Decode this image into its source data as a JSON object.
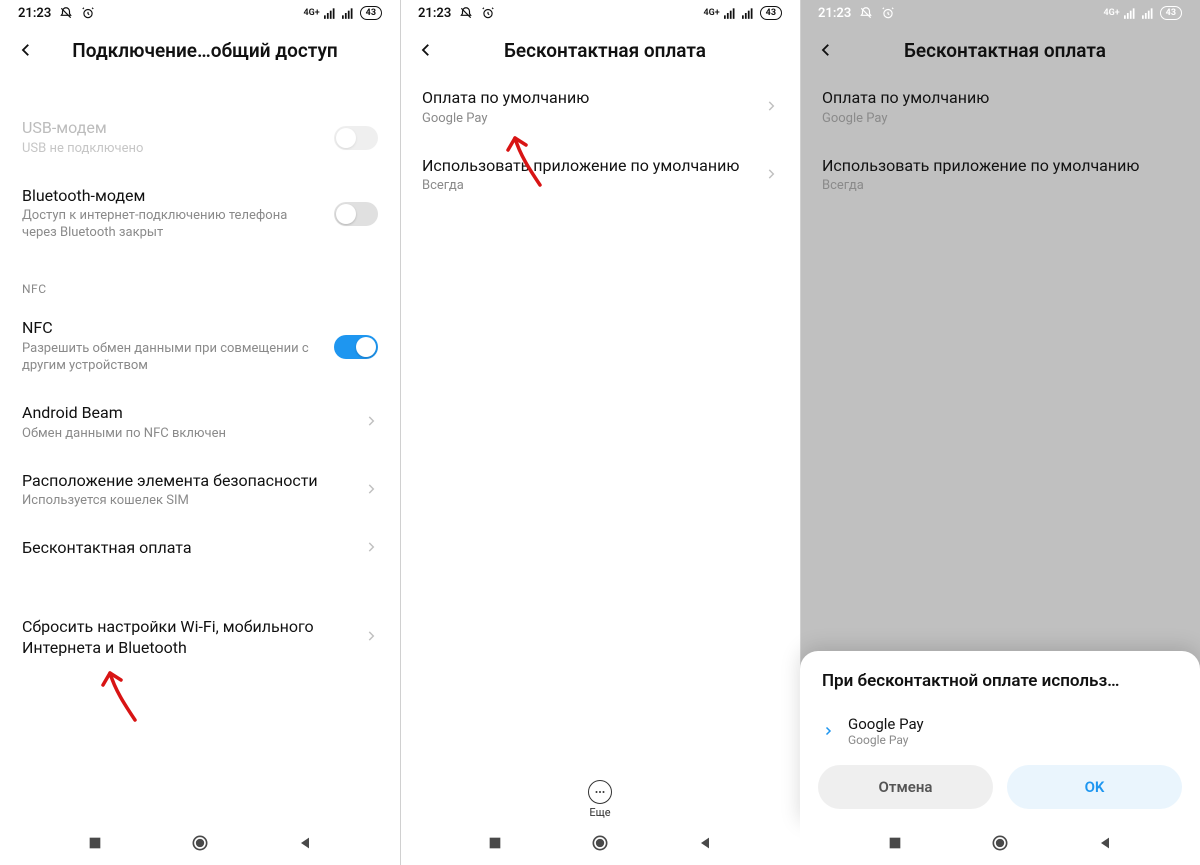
{
  "status": {
    "time": "21:23",
    "network": "4G+",
    "battery": "43"
  },
  "screen1": {
    "title": "Подключение…общий доступ",
    "usb": {
      "title": "USB-модем",
      "sub": "USB не подключено"
    },
    "bt": {
      "title": "Bluetooth-модем",
      "sub": "Доступ к интернет-подключению телефона через Bluetooth закрыт"
    },
    "section": "NFC",
    "nfc": {
      "title": "NFC",
      "sub": "Разрешить обмен данными при совмещении с другим устройством"
    },
    "beam": {
      "title": "Android Beam",
      "sub": "Обмен данными по NFC включен"
    },
    "sec": {
      "title": "Расположение элемента безопасности",
      "sub": "Используется кошелек SIM"
    },
    "pay": {
      "title": "Бесконтактная оплата"
    },
    "reset": {
      "title": "Сбросить настройки Wi-Fi, мобильного Интернета и Bluetooth"
    }
  },
  "screen2": {
    "title": "Бесконтактная оплата",
    "def": {
      "title": "Оплата по умолчанию",
      "sub": "Google Pay"
    },
    "use": {
      "title": "Использовать приложение по умолчанию",
      "sub": "Всегда"
    },
    "more": "Еще"
  },
  "screen3": {
    "title": "Бесконтактная оплата",
    "def": {
      "title": "Оплата по умолчанию",
      "sub": "Google Pay"
    },
    "use": {
      "title": "Использовать приложение по умолчанию",
      "sub": "Всегда"
    },
    "sheet": {
      "title": "При бесконтактной оплате использ…",
      "opt": {
        "title": "Google Pay",
        "sub": "Google Pay"
      },
      "cancel": "Отмена",
      "ok": "OK"
    }
  }
}
